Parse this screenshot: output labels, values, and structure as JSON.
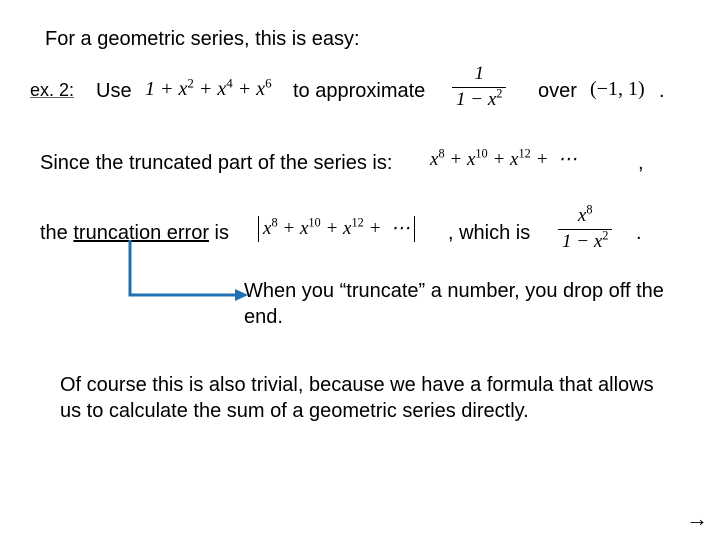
{
  "intro": "For a geometric series, this is easy:",
  "ex_label": "ex. 2:",
  "ex": {
    "use": "Use",
    "to_approx": "to approximate",
    "over": "over",
    "period": "."
  },
  "math": {
    "poly": "1 + x² + x⁴ + x⁶",
    "frac1_num": "1",
    "frac1_den": "1 − x²",
    "interval": "(−1, 1)",
    "tail_series": "x⁸ + x¹⁰ + x¹² + ⋯",
    "abs_series": "x⁸ + x¹⁰ + x¹² + ⋯",
    "frac2_num": "x⁸",
    "frac2_den": "1 − x²"
  },
  "since": {
    "text": "Since the truncated part of the series is:",
    "comma": ","
  },
  "trunc": {
    "prefix": "the ",
    "link": "truncation error",
    "mid": " is",
    "which": ", which is",
    "period": "."
  },
  "callout": "When you “truncate” a number, you drop off the end.",
  "closing": "Of course this is also trivial, because we have a formula that allows us to calculate the sum of a geometric series directly.",
  "nav": {
    "next": "→"
  }
}
